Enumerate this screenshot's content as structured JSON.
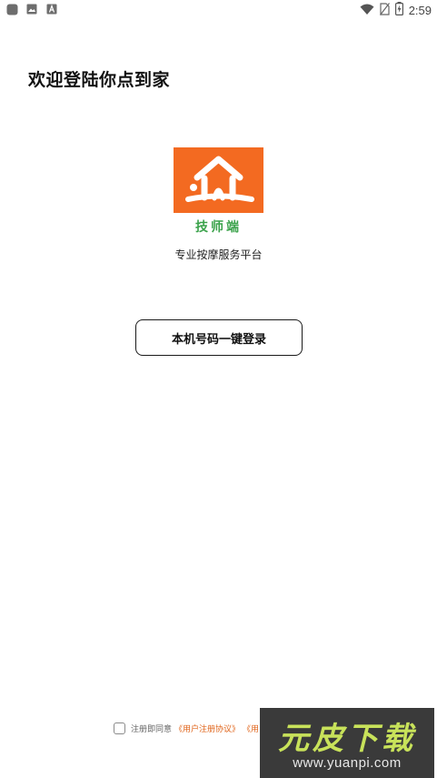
{
  "status_bar": {
    "time": "2:59",
    "left_icons": [
      "app-icon",
      "image-icon",
      "font-icon"
    ],
    "right_icons": [
      "wifi-icon",
      "no-sim-icon",
      "battery-charging-icon"
    ]
  },
  "header": {
    "welcome": "欢迎登陆你点到家"
  },
  "logo": {
    "caption": "技师端",
    "bg_color": "#f36a21",
    "caption_color": "#3aa24a"
  },
  "tagline": "专业按摩服务平台",
  "login_button": {
    "label": "本机号码一键登录"
  },
  "agreement": {
    "prefix": "注册即同意",
    "link1": "《用户注册协议》",
    "link2": "《用",
    "checked": false,
    "link_color": "#e0641a"
  },
  "watermark": {
    "title": "元皮下载",
    "url": "www.yuanpi.com"
  }
}
